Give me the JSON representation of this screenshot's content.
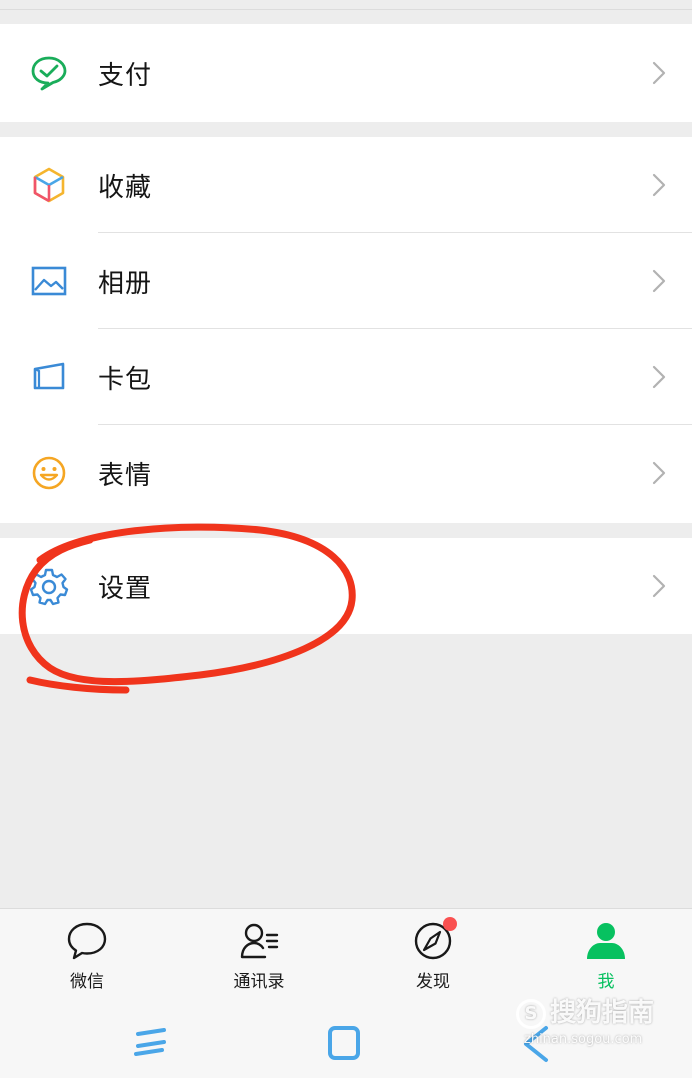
{
  "menu": {
    "pay": {
      "label": "支付",
      "icon": "wechat-pay-icon"
    },
    "items": [
      {
        "label": "收藏",
        "icon": "favorites-cube-icon"
      },
      {
        "label": "相册",
        "icon": "album-image-icon"
      },
      {
        "label": "卡包",
        "icon": "card-wallet-icon"
      },
      {
        "label": "表情",
        "icon": "smiley-face-icon"
      }
    ],
    "settings": {
      "label": "设置",
      "icon": "gear-icon"
    }
  },
  "tabbar": {
    "tabs": [
      {
        "label": "微信",
        "icon": "chat-bubble-icon",
        "active": false
      },
      {
        "label": "通讯录",
        "icon": "contacts-icon",
        "active": false
      },
      {
        "label": "发现",
        "icon": "compass-icon",
        "active": false,
        "badge_dot": true
      },
      {
        "label": "我",
        "icon": "person-icon",
        "active": true
      }
    ]
  },
  "watermark": {
    "text": "搜狗指南",
    "sub": "zhinan.sogou.com"
  },
  "colors": {
    "accent_green": "#07c160",
    "annotation_red": "#f0341c",
    "badge_red": "#fa5151"
  }
}
